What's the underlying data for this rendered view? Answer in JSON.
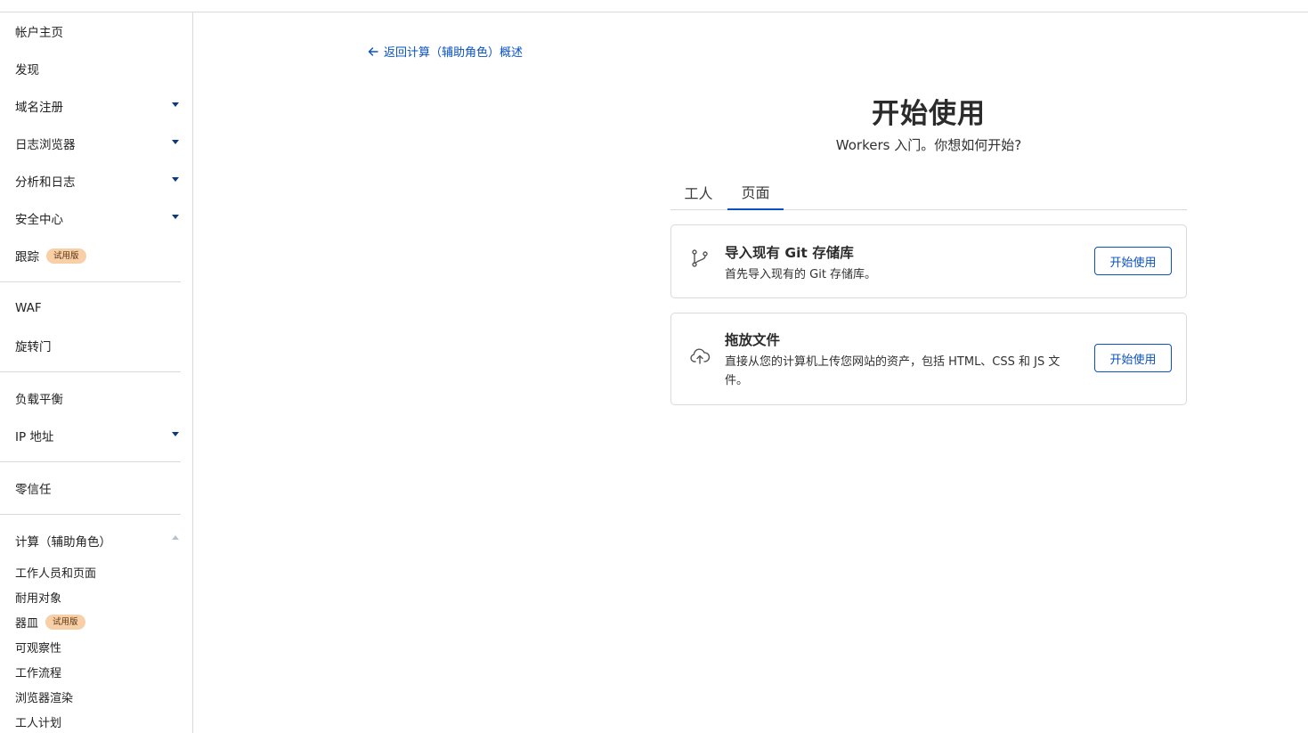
{
  "sidebar": {
    "items": [
      {
        "label": "帐户主页"
      },
      {
        "label": "发现"
      },
      {
        "label": "域名注册"
      },
      {
        "label": "日志浏览器"
      },
      {
        "label": "分析和日志"
      },
      {
        "label": "安全中心"
      },
      {
        "label": "跟踪",
        "badge": "试用版"
      },
      {
        "label": "WAF"
      },
      {
        "label": "旋转门"
      },
      {
        "label": "负载平衡"
      },
      {
        "label": "IP 地址"
      },
      {
        "label": "零信任"
      },
      {
        "label": "计算（辅助角色）"
      }
    ],
    "compute_sub": [
      {
        "label": "工作人员和页面"
      },
      {
        "label": "耐用对象"
      },
      {
        "label": "器皿",
        "badge": "试用版"
      },
      {
        "label": "可观察性"
      },
      {
        "label": "工作流程"
      },
      {
        "label": "浏览器渲染"
      },
      {
        "label": "工人计划"
      }
    ]
  },
  "main": {
    "back_link": "返回计算（辅助角色）概述",
    "title": "开始使用",
    "subtitle": "Workers 入门。你想如何开始?",
    "tabs": [
      {
        "label": "工人"
      },
      {
        "label": "页面",
        "active": true
      }
    ],
    "cards": [
      {
        "icon": "git-branch-icon",
        "title": "导入现有 Git 存储库",
        "description": "首先导入现有的 Git 存储库。",
        "button": "开始使用"
      },
      {
        "icon": "cloud-upload-icon",
        "title": "拖放文件",
        "description": "直接从您的计算机上传您网站的资产，包括 HTML、CSS 和 JS 文件。",
        "button": "开始使用"
      }
    ]
  },
  "colors": {
    "accent": "#0a51c1",
    "nav_caret": "#0b3a82",
    "badge_bg": "#f8cfa6",
    "border": "#d9d9d9"
  }
}
